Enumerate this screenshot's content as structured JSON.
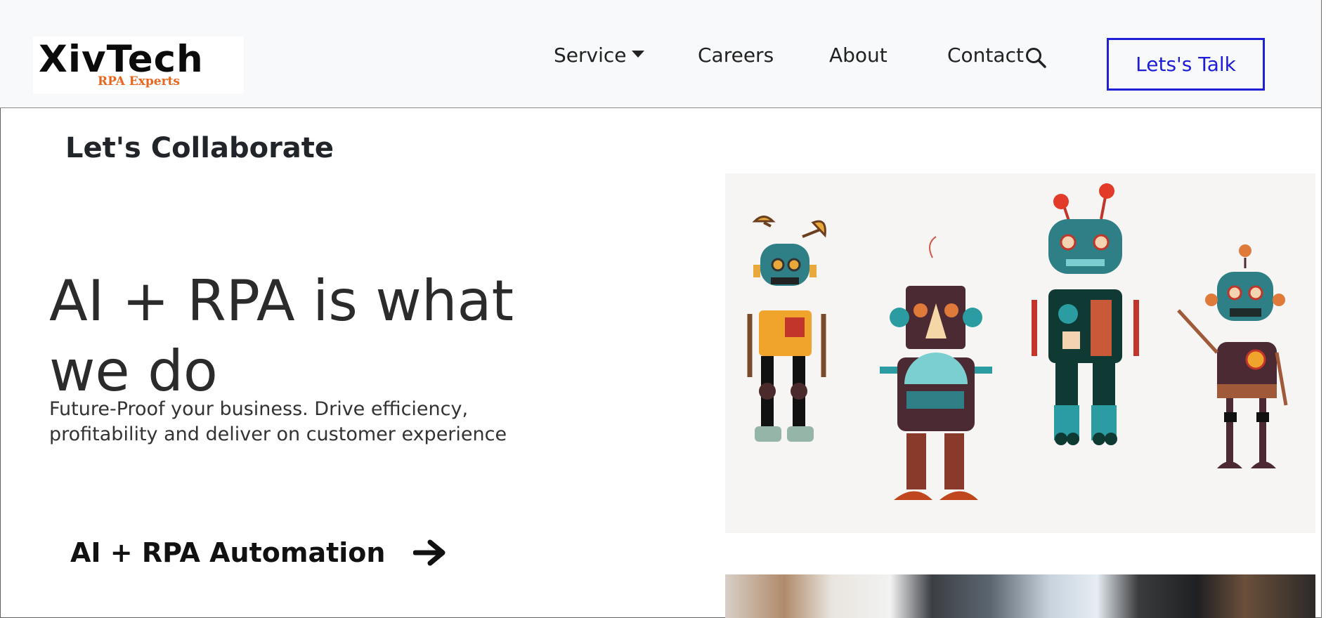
{
  "brand": {
    "name": "XivTech",
    "tagline": "RPA Experts",
    "colors": {
      "name": "#0b0b0b",
      "tagline": "#e8661e"
    }
  },
  "nav": {
    "items": [
      {
        "label": "Service",
        "has_dropdown": true
      },
      {
        "label": "Careers"
      },
      {
        "label": "About"
      },
      {
        "label": "Contact"
      }
    ],
    "search_icon": "search-icon",
    "cta_label": "Lets's Talk",
    "cta_color": "#1f1fd6"
  },
  "hero": {
    "eyebrow": "Let's Collaborate",
    "title": "AI + RPA is what we do",
    "subtitle": "Future-Proof your business. Drive efficiency, profitability and deliver on customer experience",
    "link_label": "AI + RPA Automation",
    "link_icon": "arrow-right-icon"
  }
}
